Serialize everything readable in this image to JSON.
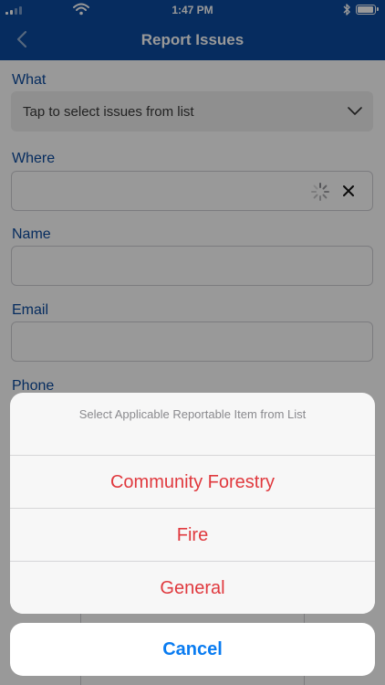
{
  "status_bar": {
    "time": "1:47 PM",
    "icons": [
      "signal-icon",
      "wifi-icon",
      "bluetooth-icon",
      "battery-icon"
    ]
  },
  "nav": {
    "title": "Report Issues",
    "back_icon": "chevron-left-icon"
  },
  "form": {
    "what": {
      "label": "What",
      "placeholder": "Tap to select issues from list"
    },
    "where": {
      "label": "Where",
      "value": ""
    },
    "name": {
      "label": "Name",
      "value": ""
    },
    "email": {
      "label": "Email",
      "value": ""
    },
    "phone": {
      "label": "Phone"
    }
  },
  "action_sheet": {
    "title": "Select Applicable Reportable Item from List",
    "options": [
      {
        "label": "Community Forestry"
      },
      {
        "label": "Fire"
      },
      {
        "label": "General"
      }
    ],
    "cancel_label": "Cancel"
  },
  "colors": {
    "brand": "#0a4a9e",
    "destructive": "#e0393e",
    "cancel": "#0a7cf1"
  }
}
